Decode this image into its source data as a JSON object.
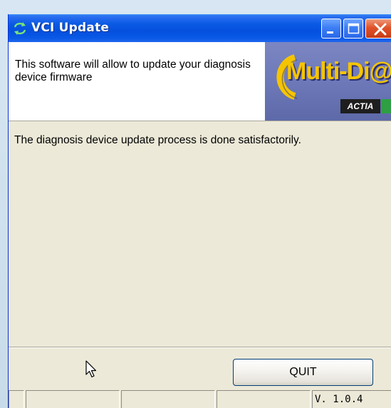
{
  "window": {
    "title": "VCI Update",
    "title_icon": "refresh-arrows-icon",
    "controls": [
      "minimize-icon",
      "maximize-icon",
      "close-icon"
    ]
  },
  "header": {
    "description": "This software will allow to update your diagnosis device firmware",
    "logo": {
      "text": "Multi-Di@g",
      "subtext": "ACTIA"
    }
  },
  "main": {
    "status_message": "The diagnosis device update process is done satisfactorily."
  },
  "actions": {
    "quit_label": "QUIT"
  },
  "statusbar": {
    "version": "V. 1.0.4"
  },
  "colors": {
    "titlebar_blue": "#0550de",
    "window_face": "#ece9d8",
    "logo_yellow": "#f5c400",
    "logo_background": "#6d79b8",
    "close_red": "#e0522a"
  }
}
